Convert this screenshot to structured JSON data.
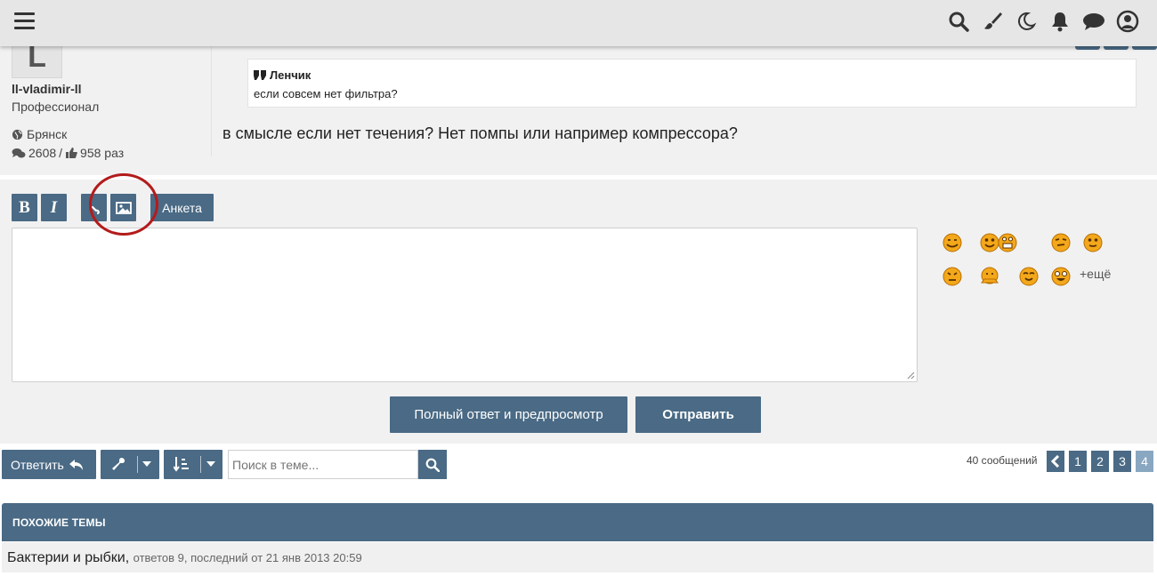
{
  "header": {
    "menu_icon": "hamburger-icon",
    "icons": [
      "search-icon",
      "paintbrush-icon",
      "moon-icon",
      "bell-icon",
      "chat-bubble-icon",
      "user-circle-icon"
    ]
  },
  "post": {
    "avatar_letter": "L",
    "username": "ll-vladimir-ll",
    "rank": "Профессионал",
    "city": "Брянск",
    "posts_count": "2608",
    "stats_separator": "/",
    "likes": "958 раз",
    "quote": {
      "author": "Ленчик",
      "text": "если совсем нет фильтра?"
    },
    "body": "в смысле если нет течения? Нет помпы или например компрессора?"
  },
  "editor": {
    "bold_label": "B",
    "italic_label": "I",
    "poll_label": "Анкета",
    "textarea_value": "",
    "smileys_more": "+ещё",
    "preview_button": "Полный ответ и предпросмотр",
    "send_button": "Отправить",
    "accent_color": "#4a6a85",
    "highlight_circle_color": "#b31b1b"
  },
  "actions": {
    "reply_label": "Ответить",
    "search_placeholder": "Поиск в теме...",
    "messages_count": "40 сообщений",
    "pages": [
      "1",
      "2",
      "3",
      "4"
    ],
    "current_page": "4"
  },
  "similar": {
    "title": "Похожие темы",
    "items": [
      {
        "title": "Бактерии и рыбки,",
        "meta": "ответов 9, последний от 21 янв 2013 20:59"
      }
    ]
  }
}
